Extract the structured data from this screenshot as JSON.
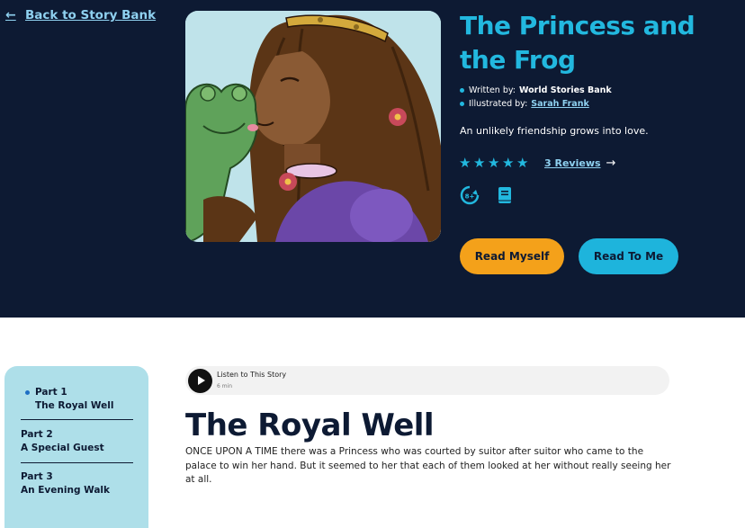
{
  "nav": {
    "back_label": "Back to Story Bank"
  },
  "story": {
    "title": "The Princess and the Frog",
    "written_by_label": "Written by:",
    "written_by": "World Stories Bank",
    "illustrated_by_label": "Illustrated by:",
    "illustrated_by": "Sarah Frank",
    "tagline": "An unlikely friendship grows into love.",
    "rating": {
      "stars": 5,
      "max": 5
    },
    "reviews_label": "3 Reviews",
    "age_badge": "8+",
    "read_myself_label": "Read Myself",
    "read_to_me_label": "Read To Me"
  },
  "sidebar": {
    "parts": [
      {
        "number": "Part 1",
        "title": "The Royal Well",
        "active": true
      },
      {
        "number": "Part 2",
        "title": "A Special Guest",
        "active": false
      },
      {
        "number": "Part 3",
        "title": "An Evening Walk",
        "active": false
      }
    ]
  },
  "audio": {
    "title": "Listen to This Story",
    "duration": "6 min"
  },
  "chapter": {
    "title": "The Royal Well",
    "paragraph1": "ONCE UPON A TIME there was a Princess who was courted by suitor after suitor who came to the palace to win her hand.  But it seemed to her that each of them looked at her without really seeing her at all."
  },
  "colors": {
    "hero_bg": "#0d1a33",
    "accent": "#22b8df",
    "read_myself": "#f4a11a",
    "read_to_me": "#1eb4dc",
    "sidebar_bg": "#aedfe9"
  },
  "icons": [
    "back-arrow-icon",
    "star-icon",
    "arrow-right-icon",
    "age-rating-icon",
    "book-icon",
    "play-icon"
  ]
}
